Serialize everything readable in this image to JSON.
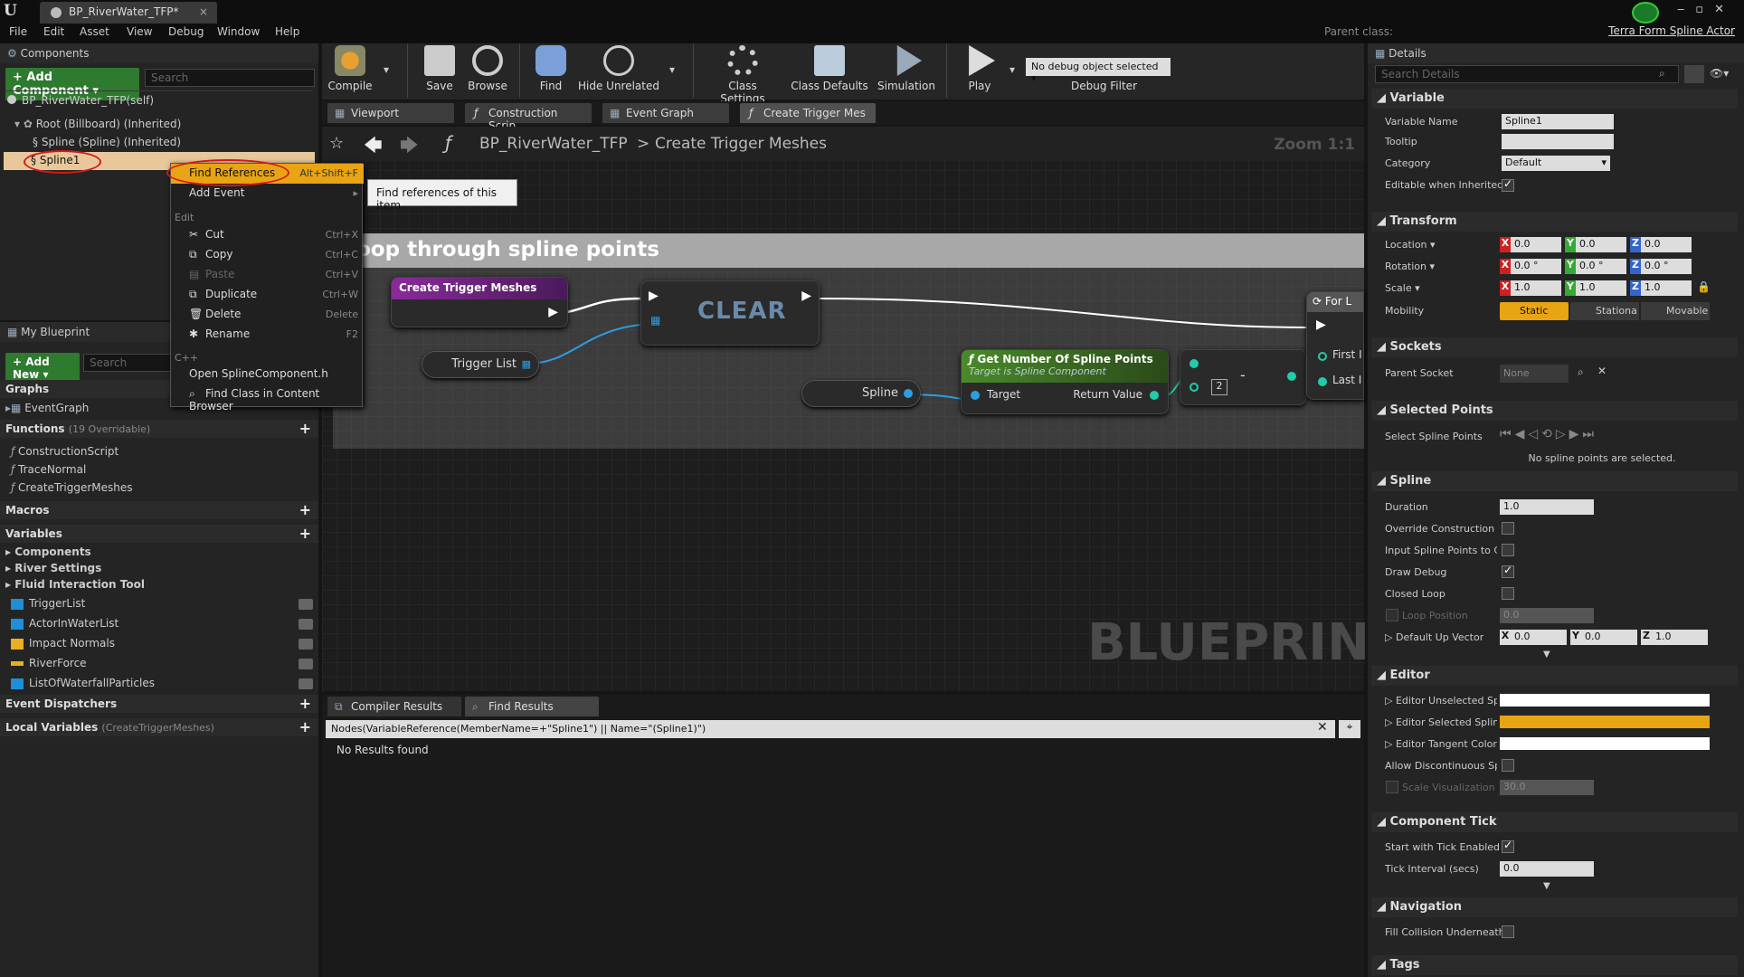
{
  "app": {
    "doc_tab": "BP_RiverWater_TFP*",
    "menu": [
      "File",
      "Edit",
      "Asset",
      "View",
      "Debug",
      "Window",
      "Help"
    ],
    "parent_class_label": "Parent class:",
    "parent_class": "Terra Form Spline Actor"
  },
  "components": {
    "tab": "Components",
    "add_button": "+ Add Component ▾",
    "search_placeholder": "Search",
    "self": "BP_RiverWater_TFP(self)",
    "root": "Root (Billboard) (Inherited)",
    "spline_inherited": "Spline (Spline) (Inherited)",
    "spline1": "Spline1"
  },
  "context_menu": {
    "find_refs": "Find References",
    "find_refs_sc": "Alt+Shift+F",
    "add_event": "Add Event",
    "edit_section": "Edit",
    "cut": "Cut",
    "cut_sc": "Ctrl+X",
    "copy": "Copy",
    "copy_sc": "Ctrl+C",
    "paste": "Paste",
    "paste_sc": "Ctrl+V",
    "duplicate": "Duplicate",
    "duplicate_sc": "Ctrl+W",
    "delete": "Delete",
    "delete_sc": "Delete",
    "rename": "Rename",
    "rename_sc": "F2",
    "cpp_section": "C++",
    "open_header": "Open SplineComponent.h",
    "find_class": "Find Class in Content Browser",
    "tooltip": "Find references of this item"
  },
  "my_blueprint": {
    "tab": "My Blueprint",
    "add_new": "+ Add New ▾",
    "search_placeholder": "Search",
    "graphs": "Graphs",
    "event_graph": "EventGraph",
    "functions": "Functions",
    "functions_override": "(19 Overridable)",
    "construction": "ConstructionScript",
    "trace_normal": "TraceNormal",
    "create_trigger": "CreateTriggerMeshes",
    "macros": "Macros",
    "variables": "Variables",
    "cat_components": "Components",
    "cat_river": "River Settings",
    "cat_fluid": "Fluid Interaction Tool",
    "vars": [
      {
        "name": "TriggerList",
        "color": "#1e8fd8"
      },
      {
        "name": "ActorInWaterList",
        "color": "#1e8fd8"
      },
      {
        "name": "Impact Normals",
        "color": "#e8b020"
      },
      {
        "name": "RiverForce",
        "color": "#e8b020"
      },
      {
        "name": "ListOfWaterfallParticles",
        "color": "#1e8fd8"
      }
    ],
    "event_dispatchers": "Event Dispatchers",
    "local_vars": "Local Variables",
    "local_vars_ctx": "(CreateTriggerMeshes)"
  },
  "toolbar": {
    "compile": "Compile",
    "save": "Save",
    "browse": "Browse",
    "find": "Find",
    "hide_unrelated": "Hide Unrelated",
    "class_settings": "Class Settings",
    "class_defaults": "Class Defaults",
    "simulation": "Simulation",
    "play": "Play",
    "debug_select": "No debug object selected ▾",
    "debug_filter": "Debug Filter"
  },
  "graph_tabs": {
    "viewport": "Viewport",
    "construction": "Construction Scrip",
    "event_graph": "Event Graph",
    "create_trigger": "Create Trigger Mes"
  },
  "graph": {
    "breadcrumb_bp": "BP_RiverWater_TFP",
    "breadcrumb_sep": ">",
    "breadcrumb_fn": "Create Trigger Meshes",
    "zoom": "Zoom 1:1",
    "comment": "oop through spline points",
    "node_entry": "Create Trigger Meshes",
    "node_clear": "CLEAR",
    "var_trigger": "Trigger List",
    "var_spline": "Spline",
    "node_getnum": "Get Number Of Spline Points",
    "node_getnum_sub": "Target is Spline Component",
    "pin_target": "Target",
    "pin_return": "Return Value",
    "minus": "-",
    "const_2": "2",
    "node_for": "For L",
    "pin_first": "First I",
    "pin_last": "Last I",
    "watermark": "BLUEPRINT"
  },
  "results": {
    "tab_compiler": "Compiler Results",
    "tab_find": "Find Results",
    "query": "Nodes(VariableReference(MemberName=+\"Spline1\") || Name=\"(Spline1)\")",
    "no_results": "No Results found"
  },
  "details": {
    "tab": "Details",
    "search_placeholder": "Search Details",
    "variable": "Variable",
    "var_name_lbl": "Variable Name",
    "var_name": "Spline1",
    "tooltip_lbl": "Tooltip",
    "category_lbl": "Category",
    "category": "Default",
    "editable_lbl": "Editable when Inherited",
    "transform": "Transform",
    "location": "Location ▾",
    "rotation": "Rotation ▾",
    "scale": "Scale ▾",
    "mobility": "Mobility",
    "loc": [
      "0.0",
      "0.0",
      "0.0"
    ],
    "rot": [
      "0.0 °",
      "0.0 °",
      "0.0 °"
    ],
    "scl": [
      "1.0",
      "1.0",
      "1.0"
    ],
    "mob_static": "Static",
    "mob_stationary": "Stationa",
    "mob_movable": "Movable",
    "sockets": "Sockets",
    "parent_socket": "Parent Socket",
    "parent_socket_val": "None",
    "selected_points": "Selected Points",
    "select_spline_points": "Select Spline Points",
    "no_points": "No spline points are selected.",
    "spline": "Spline",
    "duration": "Duration",
    "duration_val": "1.0",
    "override_construction": "Override Construction S",
    "input_points": "Input Spline Points to Cc",
    "draw_debug": "Draw Debug",
    "closed_loop": "Closed Loop",
    "loop_position": "Loop Position",
    "loop_position_val": "0.0",
    "default_up": "Default Up Vector",
    "up": [
      "0.0",
      "0.0",
      "1.0"
    ],
    "editor": "Editor",
    "unselected": "Editor Unselected Spline",
    "selected": "Editor Selected Spline S",
    "tangent": "Editor Tangent Color",
    "discontinuous": "Allow Discontinuous Spl",
    "scale_vis": "Scale Visualization \\",
    "scale_vis_val": "30.0",
    "component_tick": "Component Tick",
    "start_tick": "Start with Tick Enabled",
    "tick_interval": "Tick Interval (secs)",
    "tick_interval_val": "0.0",
    "navigation": "Navigation",
    "fill_collision": "Fill Collision Underneath",
    "tags": "Tags",
    "selected_color": "#e8a413"
  }
}
